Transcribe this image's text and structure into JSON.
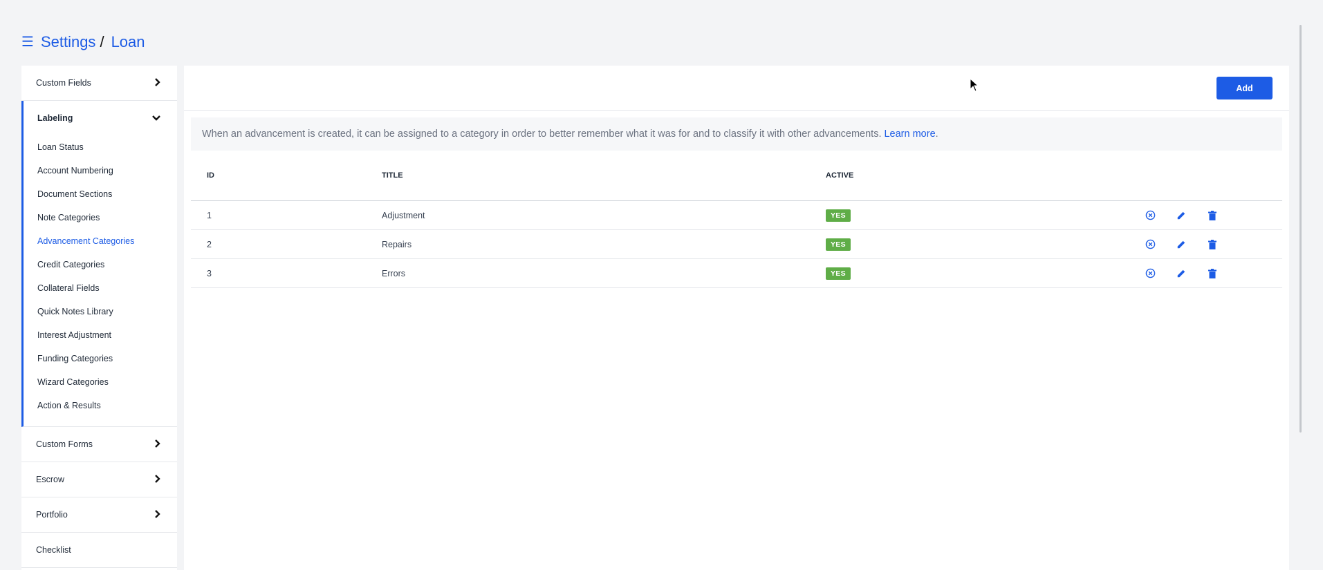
{
  "breadcrumb": {
    "menu_icon": "menu-icon",
    "root": "Settings",
    "separator": "/",
    "current": "Loan"
  },
  "sidebar": {
    "sections_top": [
      {
        "label": "Custom Fields",
        "icon": "chevron-right-icon"
      }
    ],
    "labeling": {
      "label": "Labeling",
      "icon": "chevron-down-icon",
      "items": [
        {
          "label": "Loan Status"
        },
        {
          "label": "Account Numbering"
        },
        {
          "label": "Document Sections"
        },
        {
          "label": "Note Categories"
        },
        {
          "label": "Advancement Categories",
          "active": true
        },
        {
          "label": "Credit Categories"
        },
        {
          "label": "Collateral Fields"
        },
        {
          "label": "Quick Notes Library"
        },
        {
          "label": "Interest Adjustment"
        },
        {
          "label": "Funding Categories"
        },
        {
          "label": "Wizard Categories"
        },
        {
          "label": "Action & Results"
        }
      ]
    },
    "sections_bottom": [
      {
        "label": "Custom Forms",
        "icon": "chevron-right-icon"
      },
      {
        "label": "Escrow",
        "icon": "chevron-right-icon"
      },
      {
        "label": "Portfolio",
        "icon": "chevron-right-icon"
      },
      {
        "label": "Checklist"
      }
    ]
  },
  "toolbar": {
    "add_label": "Add"
  },
  "info": {
    "text": "When an advancement is created, it can be assigned to a category in order to better remember what it was for and to classify it with other advancements.",
    "link": "Learn more",
    "trailing": "."
  },
  "table": {
    "headers": {
      "id": "ID",
      "title": "TITLE",
      "active": "ACTIVE"
    },
    "rows": [
      {
        "id": "1",
        "title": "Adjustment",
        "active": "YES"
      },
      {
        "id": "2",
        "title": "Repairs",
        "active": "YES"
      },
      {
        "id": "3",
        "title": "Errors",
        "active": "YES"
      }
    ],
    "row_actions": [
      "deactivate-icon",
      "edit-icon",
      "delete-icon"
    ]
  },
  "colors": {
    "accent": "#1d5ce5",
    "badge_green": "#5fad47",
    "background": "#f3f4f6"
  }
}
